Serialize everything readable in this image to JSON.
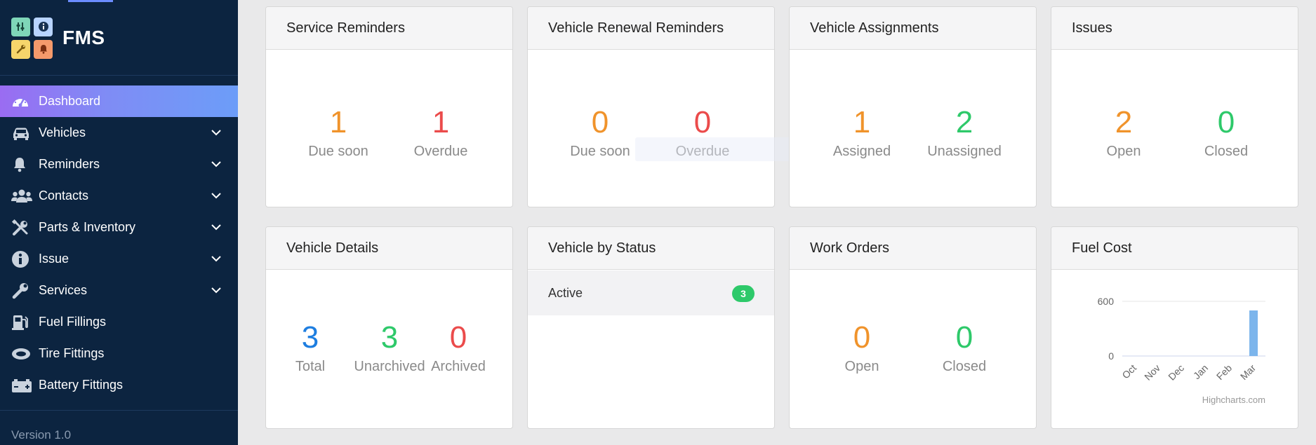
{
  "app": {
    "brand": "FMS",
    "version": "Version 1.0",
    "logo_tiles": [
      {
        "icon": "sliders-icon",
        "glyph": "⚙",
        "color": "#7fd6b8"
      },
      {
        "icon": "info-icon",
        "glyph": "i",
        "color": "#b8d4ff"
      },
      {
        "icon": "wrench-icon",
        "glyph": "🔧",
        "color": "#f6d56b"
      },
      {
        "icon": "bell-icon",
        "glyph": "🔔",
        "color": "#f59a6b"
      }
    ]
  },
  "sidebar": {
    "items": [
      {
        "label": "Dashboard",
        "icon": "speedometer-icon",
        "active": true,
        "has_submenu": false
      },
      {
        "label": "Vehicles",
        "icon": "car-icon",
        "active": false,
        "has_submenu": true
      },
      {
        "label": "Reminders",
        "icon": "bell-icon",
        "active": false,
        "has_submenu": true
      },
      {
        "label": "Contacts",
        "icon": "users-icon",
        "active": false,
        "has_submenu": true
      },
      {
        "label": "Parts & Inventory",
        "icon": "tools-icon",
        "active": false,
        "has_submenu": true
      },
      {
        "label": "Issue",
        "icon": "info-circle-icon",
        "active": false,
        "has_submenu": true
      },
      {
        "label": "Services",
        "icon": "wrench-icon",
        "active": false,
        "has_submenu": true
      },
      {
        "label": "Fuel Fillings",
        "icon": "fuel-pump-icon",
        "active": false,
        "has_submenu": false
      },
      {
        "label": "Tire Fittings",
        "icon": "tire-icon",
        "active": false,
        "has_submenu": false
      },
      {
        "label": "Battery Fittings",
        "icon": "battery-icon",
        "active": false,
        "has_submenu": false
      }
    ]
  },
  "cards": {
    "service_reminders": {
      "title": "Service Reminders",
      "stats": [
        {
          "value": "1",
          "label": "Due soon"
        },
        {
          "value": "1",
          "label": "Overdue"
        }
      ]
    },
    "vehicle_renewal_reminders": {
      "title": "Vehicle Renewal Reminders",
      "stats": [
        {
          "value": "0",
          "label": "Due soon"
        },
        {
          "value": "0",
          "label": "Overdue"
        }
      ]
    },
    "vehicle_assignments": {
      "title": "Vehicle Assignments",
      "stats": [
        {
          "value": "1",
          "label": "Assigned"
        },
        {
          "value": "2",
          "label": "Unassigned"
        }
      ]
    },
    "issues": {
      "title": "Issues",
      "stats": [
        {
          "value": "2",
          "label": "Open"
        },
        {
          "value": "0",
          "label": "Closed"
        }
      ]
    },
    "vehicle_details": {
      "title": "Vehicle Details",
      "stats": [
        {
          "value": "3",
          "label": "Total"
        },
        {
          "value": "3",
          "label": "Unarchived"
        },
        {
          "value": "0",
          "label": "Archived"
        }
      ]
    },
    "vehicle_by_status": {
      "title": "Vehicle by Status",
      "rows": [
        {
          "label": "Active",
          "count": "3"
        }
      ]
    },
    "work_orders": {
      "title": "Work Orders",
      "stats": [
        {
          "value": "0",
          "label": "Open"
        },
        {
          "value": "0",
          "label": "Closed"
        }
      ]
    },
    "fuel_cost": {
      "title": "Fuel Cost",
      "credit": "Highcharts.com"
    }
  },
  "chart_data": {
    "type": "bar",
    "title": "",
    "categories": [
      "Oct",
      "Nov",
      "Dec",
      "Jan",
      "Feb",
      "Mar"
    ],
    "values": [
      0,
      0,
      0,
      0,
      0,
      500
    ],
    "yticks": [
      "600",
      "0"
    ],
    "ylim": [
      0,
      600
    ],
    "color": "#7cb5ec",
    "xlabel": "",
    "ylabel": ""
  }
}
